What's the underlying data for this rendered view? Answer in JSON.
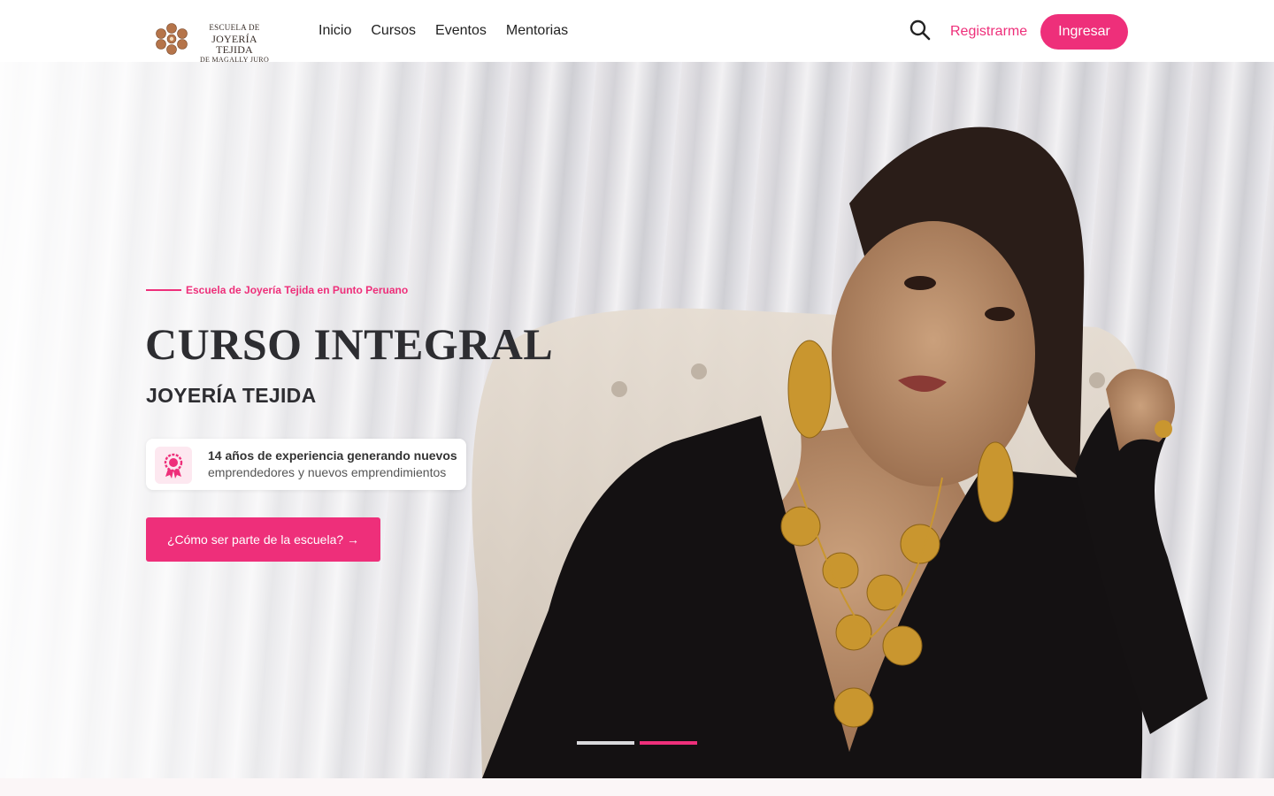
{
  "brand": {
    "line1": "ESCUELA DE",
    "line2": "JOYERÍA TEJIDA",
    "line3": "DE MAGALLY JURO"
  },
  "nav": {
    "items": [
      "Inicio",
      "Cursos",
      "Eventos",
      "Mentorias"
    ]
  },
  "header": {
    "register_label": "Registrarme",
    "login_label": "Ingresar",
    "search_icon": "search-icon"
  },
  "hero": {
    "eyebrow": "Escuela de Joyería Tejida en Punto Peruano",
    "title": "CURSO INTEGRAL",
    "subtitle": "JOYERÍA TEJIDA",
    "badge": {
      "icon": "award-ribbon-icon",
      "line1": "14 años de experiencia generando nuevos",
      "line2": "emprendedores y nuevos emprendimientos"
    },
    "cta_label": "¿Cómo ser parte de la escuela? →",
    "slides": {
      "count": 2,
      "active": 2
    }
  },
  "colors": {
    "accent": "#ee2f7a",
    "text": "#2d2d31"
  }
}
